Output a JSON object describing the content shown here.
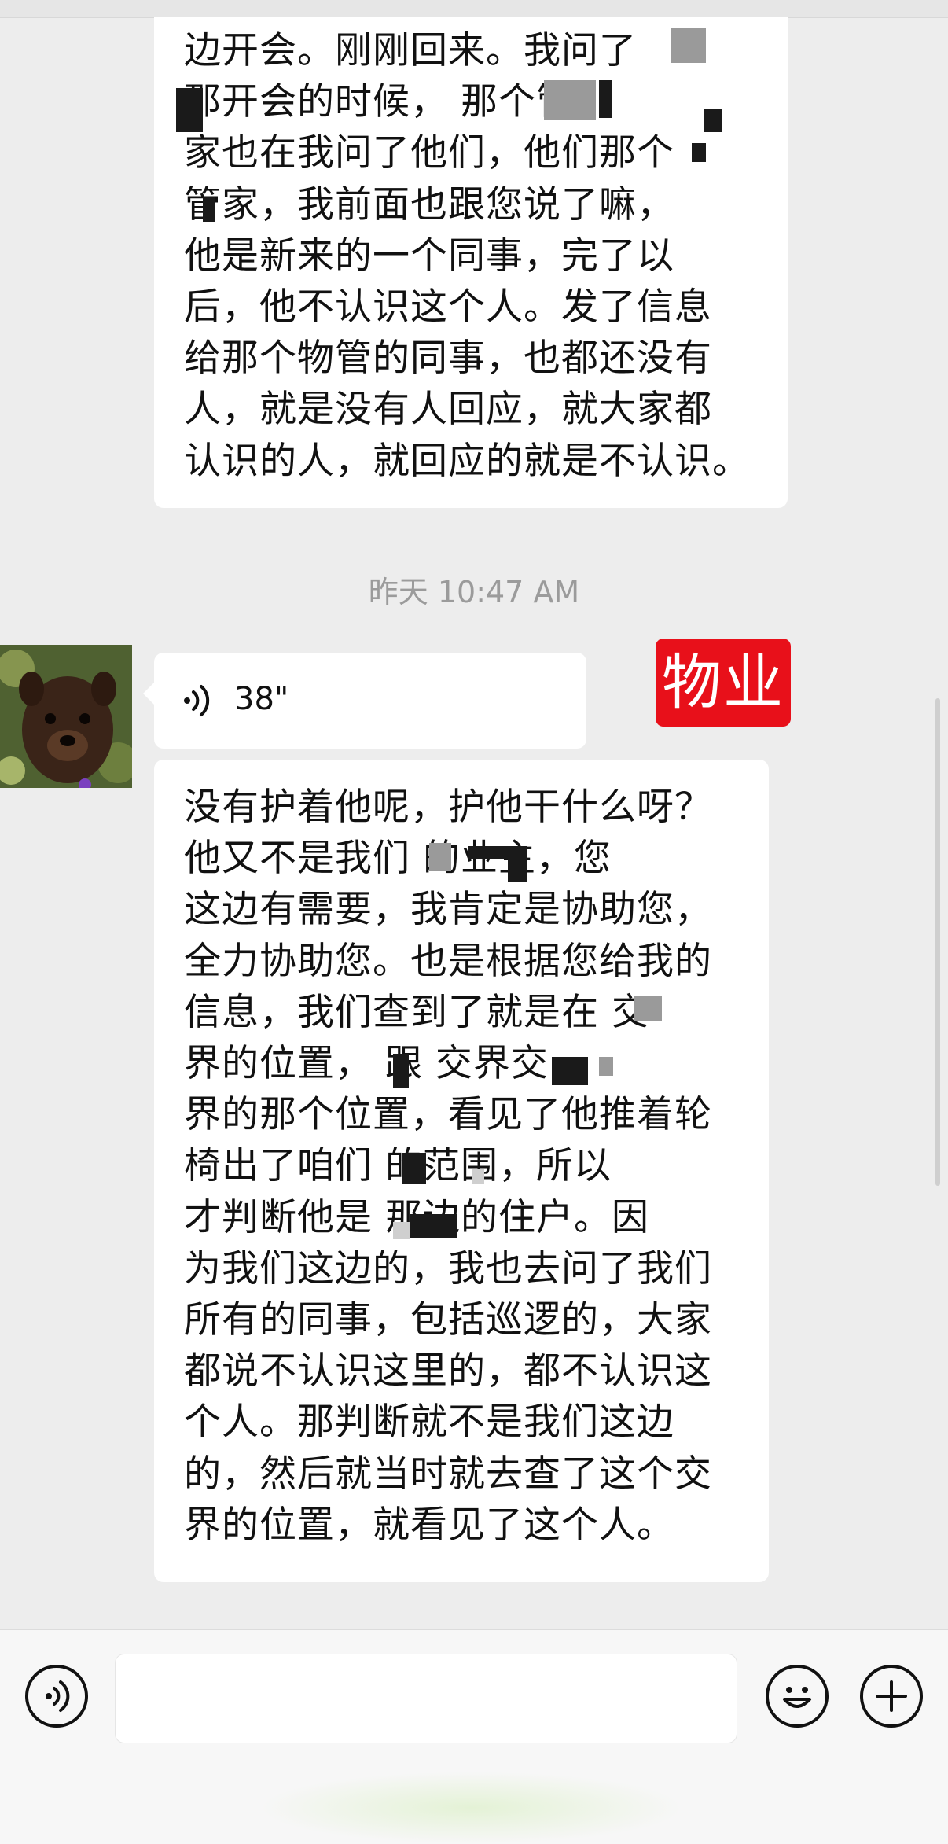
{
  "messages": [
    {
      "type": "text",
      "side": "left",
      "text": "边开会。刚刚回来。我问了\n    那开会的时候，   那个管\n家也在我问了他们，他们那个\n 管家，我前面也跟您说了嘛，\n他是新来的一个同事，完了以\n后，他不认识这个人。发了信息\n给那个物管的同事，也都还没有\n人，就是没有人回应，就大家都\n认识的人，就回应的就是不认识。"
    },
    {
      "type": "timestamp",
      "text": "昨天 10:47 AM"
    },
    {
      "type": "voice",
      "side": "left",
      "duration": "38\"",
      "sender_tag": "物业"
    },
    {
      "type": "text",
      "side": "left",
      "text": "没有护着他呢，护他干什么呀？\n他又不是我们      的业主，您\n这边有需要，我肯定是协助您，\n全力协助您。也是根据您给我的\n信息，我们查到了就是在   交\n界的位置，      跟    交界交\n界的那个位置，看见了他推着轮\n椅出了咱们      的范围，所以\n才判断他是    那边的住户。因\n为我们这边的，我也去问了我们\n所有的同事，包括巡逻的，大家\n都说不认识这里的，都不认识这\n个人。那判断就不是我们这边\n的，然后就当时就去查了这个交\n界的位置，就看见了这个人。"
    }
  ],
  "icons": {
    "voice_message": "voice-wave-icon",
    "input_voice": "voice-mode-icon",
    "emoji": "emoji-icon",
    "more": "plus-icon"
  },
  "colors": {
    "background": "#ededed",
    "bubble": "#ffffff",
    "tag": "#e8101a"
  }
}
